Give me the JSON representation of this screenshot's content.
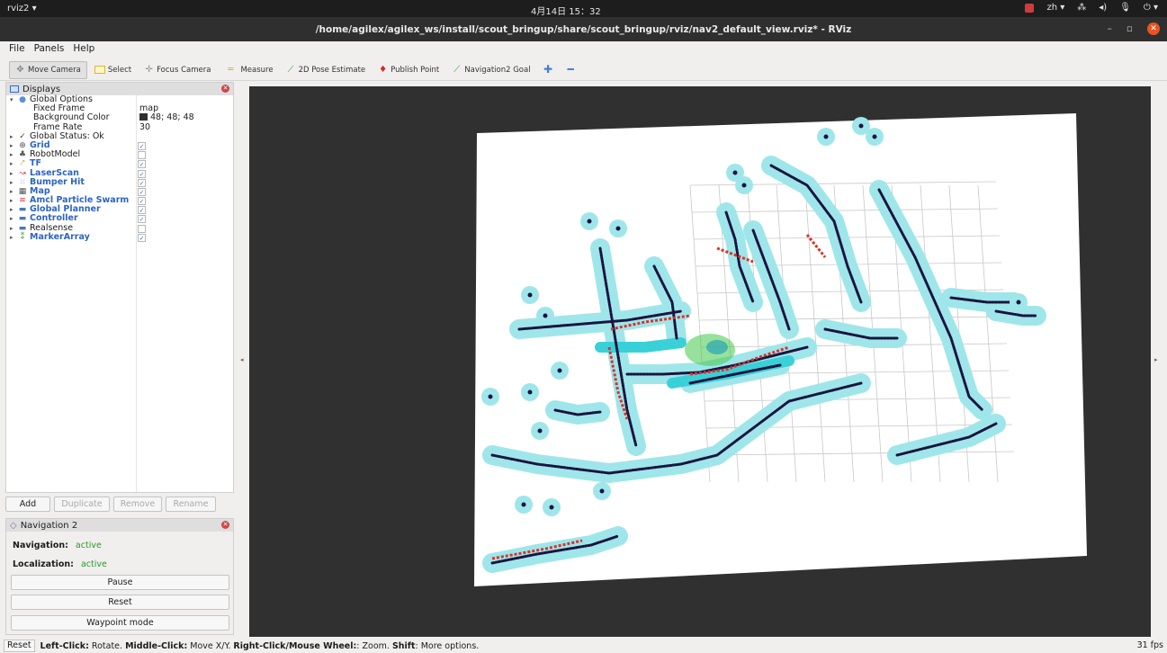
{
  "topbar": {
    "activities": "rviz2 ▾",
    "clock": "4月14日 15：32",
    "lang": "zh ▾",
    "tray_icons": [
      "network-icon",
      "volume-icon",
      "mic-icon",
      "power-icon"
    ]
  },
  "window": {
    "title": "/home/agilex/agilex_ws/install/scout_bringup/share/scout_bringup/rviz/nav2_default_view.rviz* - RViz"
  },
  "menu": [
    "File",
    "Panels",
    "Help"
  ],
  "toolbar": [
    {
      "label": "Move Camera",
      "icon": "move-camera-icon",
      "active": true
    },
    {
      "label": "Select",
      "icon": "select-icon"
    },
    {
      "label": "Focus Camera",
      "icon": "focus-camera-icon"
    },
    {
      "label": "Measure",
      "icon": "measure-icon"
    },
    {
      "label": "2D Pose Estimate",
      "icon": "pose-estimate-icon"
    },
    {
      "label": "Publish Point",
      "icon": "publish-point-icon"
    },
    {
      "label": "Navigation2 Goal",
      "icon": "nav-goal-icon"
    },
    {
      "label": "",
      "icon": "plus-icon"
    },
    {
      "label": "",
      "icon": "minus-icon"
    }
  ],
  "displays": {
    "title": "Displays",
    "global_options": "Global Options",
    "props": [
      {
        "name": "Fixed Frame",
        "value": "map"
      },
      {
        "name": "Background Color",
        "value": "48; 48; 48"
      },
      {
        "name": "Frame Rate",
        "value": "30"
      }
    ],
    "global_status": "Global Status: Ok",
    "items": [
      {
        "label": "Grid",
        "checked": true,
        "highlight": true,
        "icon": "grid-icon"
      },
      {
        "label": "RobotModel",
        "checked": false,
        "highlight": false,
        "icon": "robot-model-icon"
      },
      {
        "label": "TF",
        "checked": true,
        "highlight": true,
        "icon": "tf-icon"
      },
      {
        "label": "LaserScan",
        "checked": true,
        "highlight": true,
        "icon": "laser-scan-icon"
      },
      {
        "label": "Bumper Hit",
        "checked": true,
        "highlight": true,
        "icon": "bumper-icon"
      },
      {
        "label": "Map",
        "checked": true,
        "highlight": true,
        "icon": "map-icon"
      },
      {
        "label": "Amcl Particle Swarm",
        "checked": true,
        "highlight": true,
        "icon": "particle-icon"
      },
      {
        "label": "Global Planner",
        "checked": true,
        "highlight": true,
        "icon": "folder-icon"
      },
      {
        "label": "Controller",
        "checked": true,
        "highlight": true,
        "icon": "folder-icon"
      },
      {
        "label": "Realsense",
        "checked": false,
        "highlight": false,
        "icon": "folder-icon"
      },
      {
        "label": "MarkerArray",
        "checked": true,
        "highlight": true,
        "icon": "marker-icon"
      }
    ],
    "buttons": [
      "Add",
      "Duplicate",
      "Remove",
      "Rename"
    ]
  },
  "nav2": {
    "title": "Navigation 2",
    "navigation_label": "Navigation:",
    "navigation_value": "active",
    "localization_label": "Localization:",
    "localization_value": "active",
    "pause": "Pause",
    "reset": "Reset",
    "waypoint": "Waypoint mode"
  },
  "colors": {
    "viewport_bg": "#303030",
    "costmap": "#9fe6ea",
    "inflation_core": "#3ad0d8",
    "obstacle": "#1a1440",
    "laser": "#d8322a",
    "grid": "#c8c8c8",
    "active_green": "#2a9a2a"
  },
  "status": {
    "reset": "Reset",
    "hint_left_key": "Left-Click:",
    "hint_left": " Rotate. ",
    "hint_mid_key": "Middle-Click:",
    "hint_mid": " Move X/Y. ",
    "hint_right_key": "Right-Click/Mouse Wheel:",
    "hint_right": ": Zoom. ",
    "hint_shift_key": "Shift",
    "hint_shift": ": More options.",
    "fps": "31 fps"
  }
}
